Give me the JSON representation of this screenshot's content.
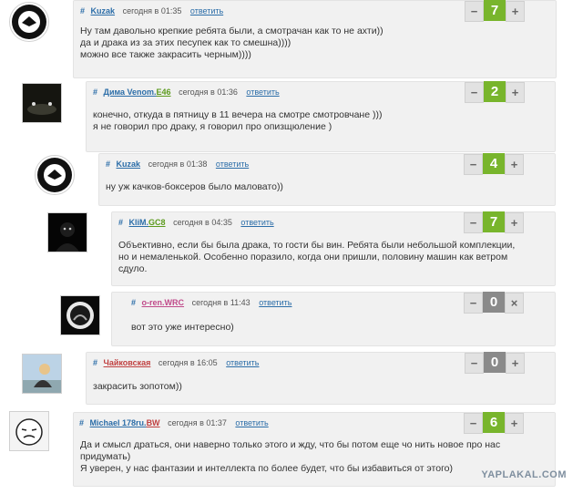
{
  "reply_label": "ответить",
  "watermark": "YAPLAKAL.COM",
  "comments": [
    {
      "hash": "#",
      "nick": "Kuzak",
      "nick_suffix": "",
      "time": "сегодня в 01:35",
      "score": "7",
      "score_type": "pos",
      "lines": [
        "Ну там давольно крепкие ребята были, а смотрачан как то не ахти))",
        "да и драка из за этих песупек как то смешна))))",
        "можно все также закрасить черным))))"
      ]
    },
    {
      "hash": "#",
      "nick": "Дима Venom.",
      "nick_suffix": "E46",
      "time": "сегодня в 01:36",
      "score": "2",
      "score_type": "pos",
      "lines": [
        "конечно, откуда в пятницу в 11 вечера на смотре смотровчане )))",
        "я не говорил про драку, я говорил про опизщюление )"
      ]
    },
    {
      "hash": "#",
      "nick": "Kuzak",
      "nick_suffix": "",
      "time": "сегодня в 01:38",
      "score": "4",
      "score_type": "pos",
      "lines": [
        "ну уж качков-боксеров было маловато))"
      ]
    },
    {
      "hash": "#",
      "nick": "KliM.",
      "nick_suffix": "GC8",
      "time": "сегодня в 04:35",
      "score": "7",
      "score_type": "pos",
      "lines": [
        "Объективно, если бы была драка, то гости бы вин. Ребята были небольшой комплекции,",
        "но и немаленькой. Особенно поразило, когда они пришли, половину машин как ветром",
        "сдуло."
      ]
    },
    {
      "hash": "#",
      "nick": "o-ren.",
      "nick_suffix": "WRC",
      "time": "сегодня в 11:43",
      "score": "0",
      "score_type": "zero",
      "lines": [
        "вот это уже интересно)"
      ]
    },
    {
      "hash": "#",
      "nick": "Чайковская",
      "nick_suffix": "",
      "time": "сегодня в 16:05",
      "score": "0",
      "score_type": "zero",
      "lines": [
        "закрасить зопотом))"
      ]
    },
    {
      "hash": "#",
      "nick": "Michael 178ru.",
      "nick_suffix": "BW",
      "time": "сегодня в 01:37",
      "score": "6",
      "score_type": "pos",
      "lines": [
        "Да и смысл драться, они наверно только этого и жду, что бы потом еще чо нить новое про нас",
        "придумать)",
        "Я уверен, у нас фантазии и интеллекта по более будет, что бы избавиться от этого)"
      ]
    }
  ]
}
